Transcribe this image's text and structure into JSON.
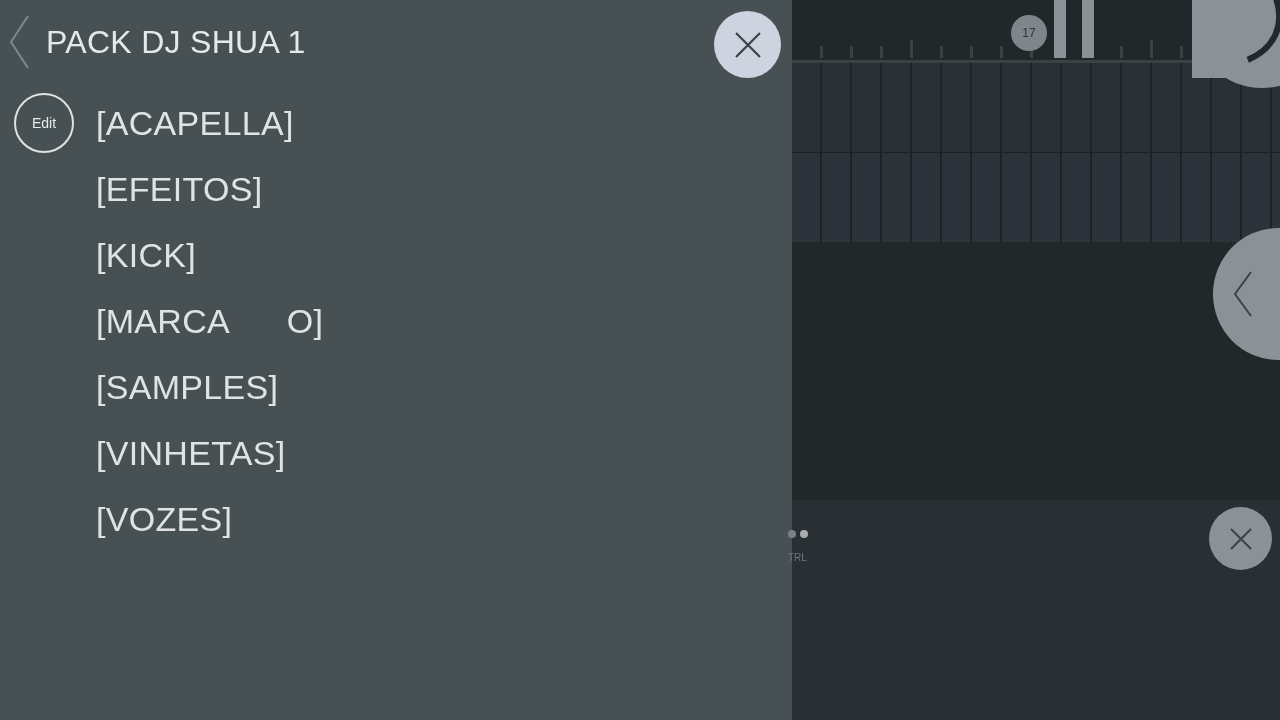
{
  "browser": {
    "title": "PACK DJ SHUA 1",
    "edit_label": "Edit",
    "folders": [
      {
        "label": "[ACAPELLA]"
      },
      {
        "label": "[EFEITOS]"
      },
      {
        "label": "[KICK]"
      },
      {
        "label": "[MARCA      O]"
      },
      {
        "label": "[SAMPLES]"
      },
      {
        "label": "[VINHETAS]"
      },
      {
        "label": "[VOZES]"
      }
    ]
  },
  "playlist": {
    "bar_marker": "17",
    "control_label": "TRL"
  }
}
